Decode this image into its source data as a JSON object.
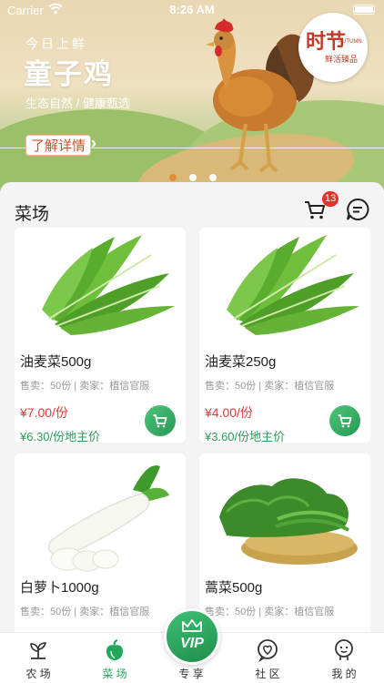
{
  "status_bar": {
    "carrier": "Carrier",
    "time": "8:26 AM"
  },
  "banner": {
    "subtitle": "今日上鲜",
    "title": "童子鸡",
    "slogan": "生态自然 / 健康甄选",
    "button_label": "了解详情",
    "badge_main": "时节",
    "badge_en": "AUTUMN",
    "badge_sub": "鲜活臻品",
    "page_count": 3,
    "active_page": 1
  },
  "section": {
    "title": "菜场",
    "cart_count": "13"
  },
  "products": [
    {
      "name": "油麦菜500g",
      "meta": "售卖：50份 | 卖家：植信官服",
      "price": "¥7.00/份",
      "member_price": "¥6.30/份地主价",
      "image": "lettuce"
    },
    {
      "name": "油麦菜250g",
      "meta": "售卖：50份 | 卖家：植信官服",
      "price": "¥4.00/份",
      "member_price": "¥3.60/份地主价",
      "image": "lettuce"
    },
    {
      "name": "白萝卜1000g",
      "meta": "售卖：50份 | 卖家：植信官服",
      "price": "",
      "member_price": "",
      "image": "radish"
    },
    {
      "name": "蒿菜500g",
      "meta": "售卖：50份 | 卖家：植信官服",
      "price": "",
      "member_price": "",
      "image": "greens-basket"
    }
  ],
  "tabbar": {
    "items": [
      {
        "label": "农 场",
        "icon": "sprout-icon"
      },
      {
        "label": "菜 场",
        "icon": "vegetable-icon"
      },
      {
        "label": "专 享",
        "icon": "vip-crown-icon"
      },
      {
        "label": "社 区",
        "icon": "community-heart-icon"
      },
      {
        "label": "我 的",
        "icon": "profile-icon"
      }
    ],
    "vip_label": "VIP",
    "active": 1
  },
  "colors": {
    "accent": "#23a75b",
    "price": "#e33a3a",
    "badge": "#e3322b",
    "banner_button": "#c9522b"
  }
}
